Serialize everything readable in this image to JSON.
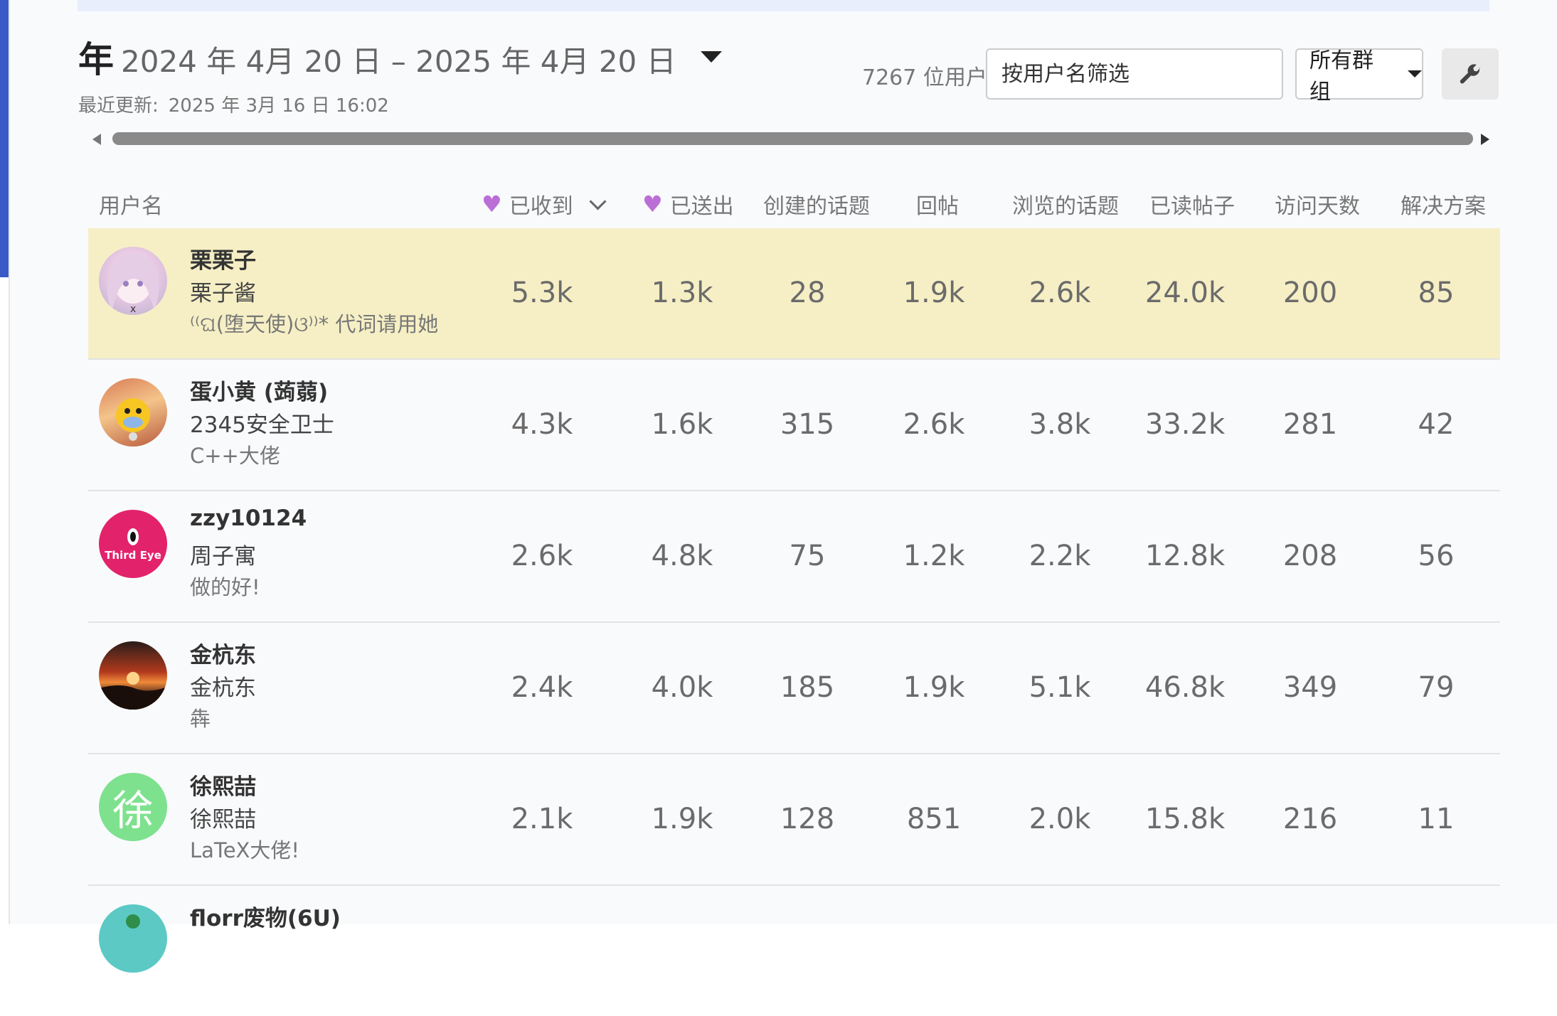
{
  "period": {
    "label_year": "年",
    "range": "2024 年 4月 20 日 – 2025 年 4月 20 日"
  },
  "last_updated": {
    "label": "最近更新:",
    "value": "2025 年 3月 16 日 16:02"
  },
  "toolbar": {
    "user_count": "7267 位用户",
    "search_placeholder": "按用户名筛选",
    "group_select": "所有群组",
    "settings_icon": "wrench-icon"
  },
  "columns": {
    "username": "用户名",
    "likes_received": "已收到",
    "likes_given": "已送出",
    "topics_created": "创建的话题",
    "replies": "回帖",
    "topics_viewed": "浏览的话题",
    "posts_read": "已读帖子",
    "days_visited": "访问天数",
    "solutions": "解决方案"
  },
  "colors": {
    "heart": "#bb6fd6",
    "highlight_row": "#f6efc5"
  },
  "rows": [
    {
      "username": "栗栗子",
      "name": "栗子酱",
      "title": "⁽⁽ଘ(堕天使)ଓ⁾⁾* 代词请用她",
      "likes_received": "5.3k",
      "likes_given": "1.3k",
      "topics_created": "28",
      "replies": "1.9k",
      "topics_viewed": "2.6k",
      "posts_read": "24.0k",
      "days_visited": "200",
      "solutions": "85",
      "avatar": "anime-girl-avatar"
    },
    {
      "username": "蛋小黄 (蒟蒻)",
      "name": "2345安全卫士",
      "title": "C++大佬",
      "likes_received": "4.3k",
      "likes_given": "1.6k",
      "topics_created": "315",
      "replies": "2.6k",
      "topics_viewed": "3.8k",
      "posts_read": "33.2k",
      "days_visited": "281",
      "solutions": "42",
      "avatar": "yellow-mascot-avatar"
    },
    {
      "username": "zzy10124",
      "name": "周子寓",
      "title": "做的好!",
      "likes_received": "2.6k",
      "likes_given": "4.8k",
      "topics_created": "75",
      "replies": "1.2k",
      "topics_viewed": "2.2k",
      "posts_read": "12.8k",
      "days_visited": "208",
      "solutions": "56",
      "avatar": "third-eye-avatar",
      "avatar_text": "Third Eye"
    },
    {
      "username": "金杭东",
      "name": "金杭东",
      "title": "犇",
      "likes_received": "2.4k",
      "likes_given": "4.0k",
      "topics_created": "185",
      "replies": "1.9k",
      "topics_viewed": "5.1k",
      "posts_read": "46.8k",
      "days_visited": "349",
      "solutions": "79",
      "avatar": "sunset-avatar"
    },
    {
      "username": "徐熙喆",
      "name": "徐熙喆",
      "title": "LaTeX大佬!",
      "likes_received": "2.1k",
      "likes_given": "1.9k",
      "topics_created": "128",
      "replies": "851",
      "topics_viewed": "2.0k",
      "posts_read": "15.8k",
      "days_visited": "216",
      "solutions": "11",
      "avatar": "letter-avatar",
      "avatar_text": "徐"
    },
    {
      "username": "florr废物(6U)",
      "avatar": "teal-avatar"
    }
  ]
}
